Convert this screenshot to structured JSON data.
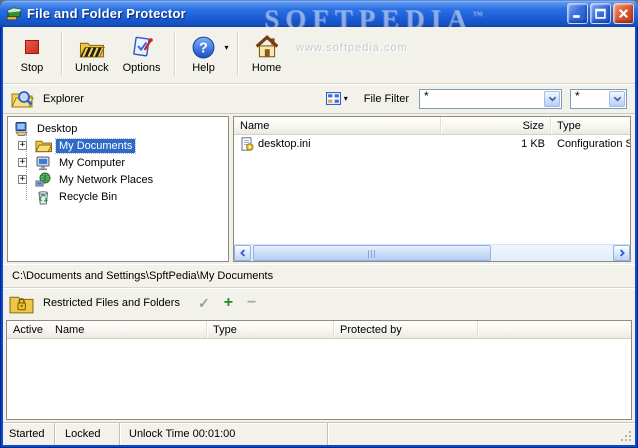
{
  "window": {
    "title": "File and Folder Protector"
  },
  "watermark": {
    "brand": "SOFTPEDIA",
    "tm": "™",
    "url": "www.softpedia.com"
  },
  "titlebar_buttons": {
    "minimize": "minimize",
    "maximize": "maximize",
    "close": "close"
  },
  "toolbar": {
    "stop": "Stop",
    "unlock": "Unlock",
    "options": "Options",
    "help": "Help",
    "home": "Home"
  },
  "explorer_bar": {
    "title": "Explorer",
    "file_filter_label": "File Filter",
    "filter_primary": "*",
    "filter_secondary": "*"
  },
  "tree": {
    "items": [
      {
        "label": "Desktop",
        "icon": "desktop-icon",
        "expandable": false,
        "selected": false
      },
      {
        "label": "My Documents",
        "icon": "my-documents-icon",
        "expandable": true,
        "selected": true
      },
      {
        "label": "My Computer",
        "icon": "my-computer-icon",
        "expandable": true,
        "selected": false
      },
      {
        "label": "My Network Places",
        "icon": "network-places-icon",
        "expandable": true,
        "selected": false
      },
      {
        "label": "Recycle Bin",
        "icon": "recycle-bin-icon",
        "expandable": false,
        "selected": false
      }
    ]
  },
  "file_list": {
    "columns": {
      "name": "Name",
      "size": "Size",
      "type": "Type"
    },
    "rows": [
      {
        "name": "desktop.ini",
        "size": "1 KB",
        "type": "Configuration Settings"
      }
    ]
  },
  "path_bar": {
    "path": "C:\\Documents and Settings\\SpftPedia\\My Documents"
  },
  "restricted": {
    "title": "Restricted Files and Folders",
    "actions": {
      "apply": "✓",
      "add": "+",
      "remove": "−"
    },
    "columns": {
      "active": "Active",
      "name": "Name",
      "type": "Type",
      "protected_by": "Protected by"
    }
  },
  "status_bar": {
    "started": "Started",
    "locked": "Locked",
    "unlock_time": "Unlock Time 00:01:00"
  },
  "colors": {
    "titlebar_blue": "#1a5bd4",
    "selection_blue": "#316ac5",
    "face": "#f2f1ea",
    "close_red": "#e05a31",
    "plus_green": "#1e8f1e"
  }
}
